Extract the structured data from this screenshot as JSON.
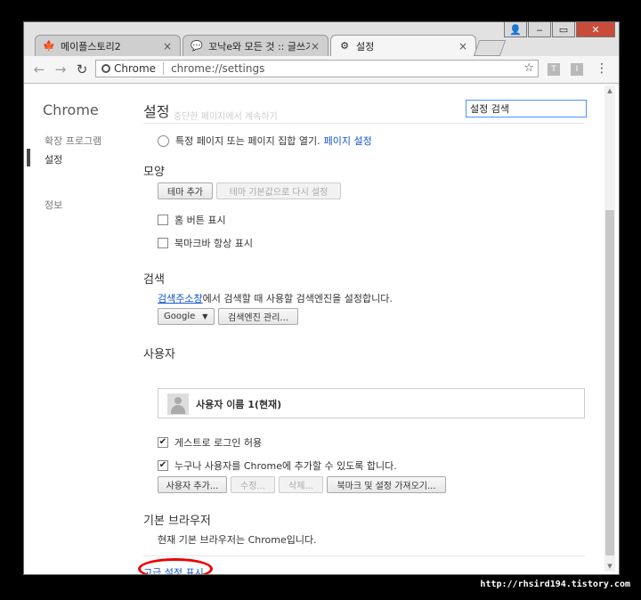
{
  "tabs": [
    {
      "label": "메이플스토리2",
      "icon": "maple-icon",
      "close": "×"
    },
    {
      "label": "꼬낙e와 모든 것 :: 글쓰기",
      "icon": "blog-icon",
      "close": "×"
    },
    {
      "label": "설정",
      "icon": "gear-icon",
      "close": "×"
    }
  ],
  "omnibox": {
    "chip": "Chrome",
    "url": "chrome://settings"
  },
  "extensions": [
    "T",
    "I"
  ],
  "sidebar": {
    "brand": "Chrome",
    "items": [
      {
        "label": "확장 프로그램"
      },
      {
        "label": "설정"
      },
      {
        "label": "정보"
      }
    ]
  },
  "main": {
    "title": "설정",
    "faded_text": "중단한 페이지에서 계속하기",
    "search_value": "설정 검색",
    "startup": {
      "option": "특정 페이지 또는 페이지 집합 열기.",
      "link": "페이지 설정"
    },
    "appearance": {
      "heading": "모양",
      "theme_button": "테마 추가",
      "reset_theme_button": "테마 기본값으로 다시 설정",
      "home_button_label": "홈 버튼 표시",
      "bookmarks_bar_label": "북마크바 항상 표시"
    },
    "search": {
      "heading": "검색",
      "link": "검색주소창",
      "description": "에서 검색할 때 사용할 검색엔진을 설정합니다.",
      "engine": "Google",
      "manage_button": "검색엔진 관리..."
    },
    "users": {
      "heading": "사용자",
      "user_name": "사용자 이름 1(현재)",
      "guest_label": "게스트로 로그인 허용",
      "add_anyone_label": "누구나 사용자를 Chrome에 추가할 수 있도록 합니다.",
      "add_user_button": "사용자 추가...",
      "edit_button": "수정...",
      "delete_button": "삭제...",
      "import_button": "북마크 및 설정 가져오기..."
    },
    "default_browser": {
      "heading": "기본 브라우저",
      "description": "현재 기본 브라우저는 Chrome입니다."
    },
    "advanced_link": "고급 설정 표시"
  },
  "watermark": "http://rhsird194.tistory.com",
  "colors": {
    "link": "#1155cc",
    "highlight": "#ee0000"
  }
}
